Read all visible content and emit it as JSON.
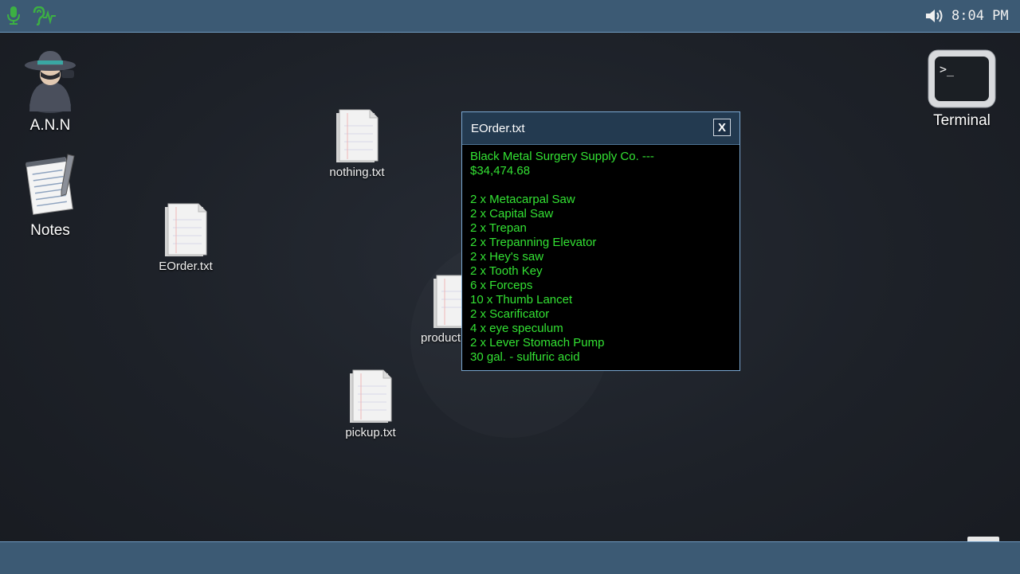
{
  "topbar": {
    "icons": [
      "microphone-icon",
      "ear-listening-icon",
      "speaker-volume-icon"
    ],
    "clock": "8:04 PM"
  },
  "desktop": {
    "apps": [
      {
        "label": "A.N.N",
        "icon": "agent-avatar-icon"
      },
      {
        "label": "Notes",
        "icon": "notepad-icon"
      },
      {
        "label": "Terminal",
        "icon": "terminal-icon"
      }
    ],
    "files": [
      {
        "label": "nothing.txt"
      },
      {
        "label": "EOrder.txt"
      },
      {
        "label": "product"
      },
      {
        "label": "pickup.txt"
      }
    ]
  },
  "window": {
    "title": "EOrder.txt",
    "close_label": "X",
    "header_line1": "Black Metal Surgery Supply Co. ---",
    "header_line2": "$34,474.68",
    "items": [
      "2 x Metacarpal Saw",
      "2 x Capital Saw",
      "2 x Trepan",
      "2 x Trepanning Elevator",
      "2 x Hey's saw",
      "2 x Tooth Key",
      "6 x Forceps",
      "10 x Thumb Lancet",
      "2 x Scarificator",
      "4 x eye speculum",
      "2 x Lever Stomach Pump",
      "30 gal. - sulfuric acid"
    ]
  },
  "colors": {
    "bar": "#3c5a74",
    "window_title": "#233a50",
    "terminal_text": "#33e233",
    "accent_icon": "#3cb043"
  }
}
